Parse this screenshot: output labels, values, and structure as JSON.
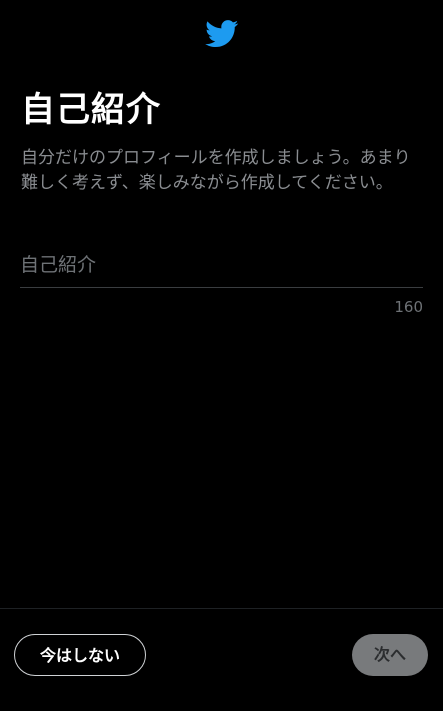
{
  "header": {
    "logo_icon": "twitter-bird-icon",
    "logo_color": "#1d9bf0"
  },
  "main": {
    "title": "自己紹介",
    "description": "自分だけのプロフィールを作成しましょう。あまり難しく考えず、楽しみながら作成してください。",
    "bio_field": {
      "placeholder": "自己紹介",
      "value": ""
    },
    "char_count": "160"
  },
  "footer": {
    "skip_label": "今はしない",
    "next_label": "次へ"
  }
}
